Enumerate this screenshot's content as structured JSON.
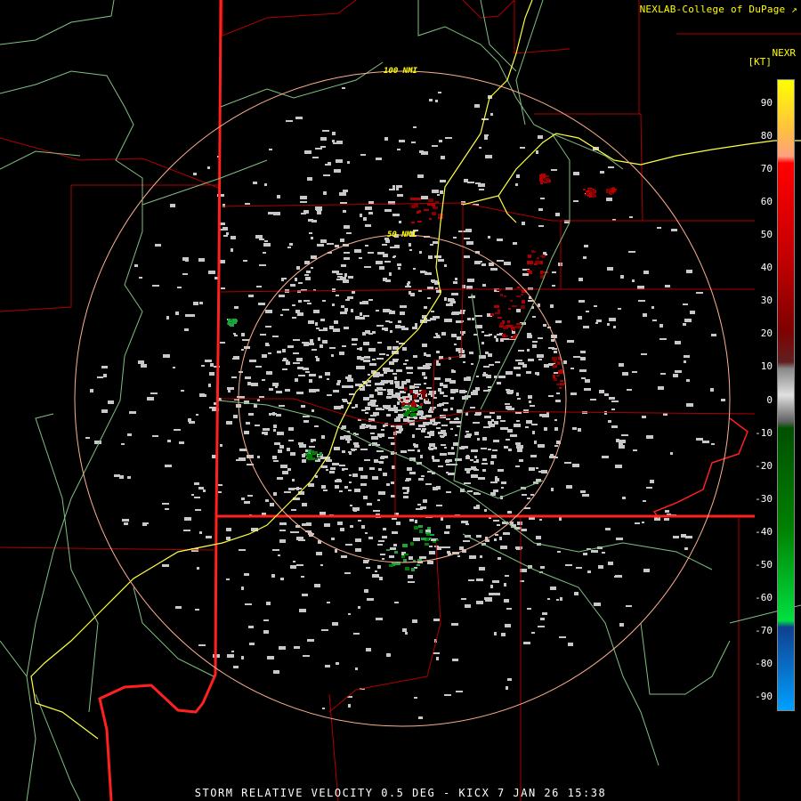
{
  "credit": "NEXLAB-College of DuPage ↗",
  "product": "NEXR",
  "units": "[KT]",
  "footer": "STORM RELATIVE VELOCITY 0.5 DEG - KICX 7 JAN 26 15:38",
  "range_rings": [
    {
      "label": "100 NMI"
    },
    {
      "label": "50 NMI"
    }
  ],
  "colorbar": {
    "ticks": [
      "90",
      "80",
      "70",
      "60",
      "50",
      "40",
      "30",
      "20",
      "10",
      "0",
      "-10",
      "-20",
      "-30",
      "-40",
      "-50",
      "-60",
      "-70",
      "-80",
      "-90"
    ],
    "stops": [
      {
        "value": 95,
        "color": "#ffff00"
      },
      {
        "value": 80,
        "color": "#ffc040"
      },
      {
        "value": 72,
        "color": "#ffa080"
      },
      {
        "value": 70,
        "color": "#ff0000"
      },
      {
        "value": 40,
        "color": "#c00000"
      },
      {
        "value": 20,
        "color": "#800000"
      },
      {
        "value": 10,
        "color": "#602020"
      },
      {
        "value": 8,
        "color": "#888888"
      },
      {
        "value": 0,
        "color": "#e0e0e0"
      },
      {
        "value": -8,
        "color": "#606060"
      },
      {
        "value": -10,
        "color": "#005000"
      },
      {
        "value": -40,
        "color": "#008000"
      },
      {
        "value": -68,
        "color": "#00e040"
      },
      {
        "value": -70,
        "color": "#104090"
      },
      {
        "value": -95,
        "color": "#00a0ff"
      }
    ]
  },
  "colors": {
    "state_border": "#ff2020",
    "county_border": "#b00000",
    "river": "#ffff44",
    "highway": "#80c080",
    "ring": "#ffb090",
    "clutter": "#c8c8c8"
  }
}
